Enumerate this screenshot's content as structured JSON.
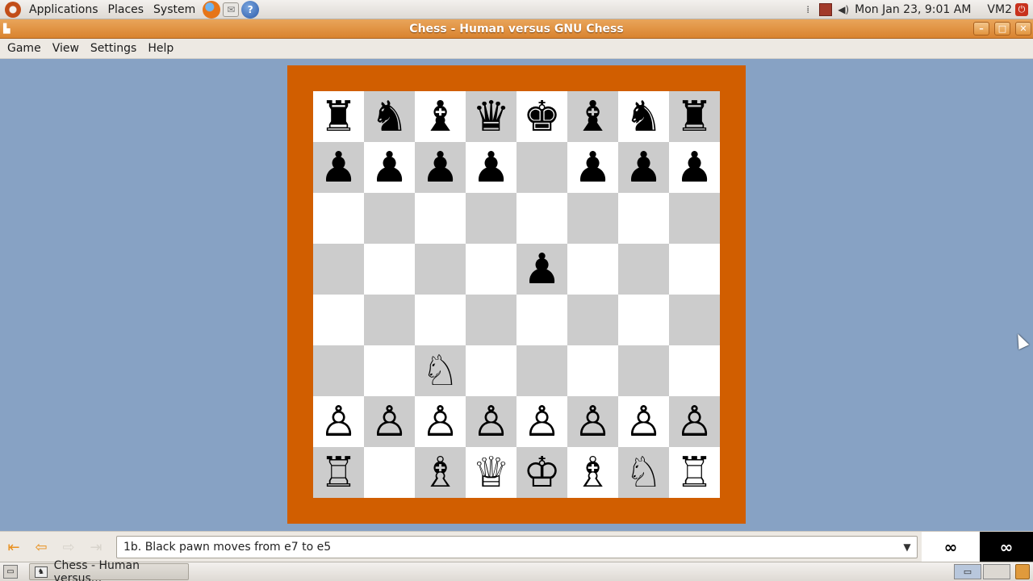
{
  "top_panel": {
    "menus": [
      "Applications",
      "Places",
      "System"
    ],
    "clock": "Mon Jan 23,  9:01 AM",
    "vm_label": "VM2",
    "icons": [
      "ubuntu-logo",
      "firefox-icon",
      "mail-icon",
      "help-icon",
      "network-icon",
      "volume-icon",
      "power-icon"
    ]
  },
  "window": {
    "title": "Chess - Human versus GNU Chess"
  },
  "menubar": {
    "game": "Game",
    "view": "View",
    "settings": "Settings",
    "help": "Help"
  },
  "board": {
    "light_color": "#ffffff",
    "dark_color": "#cccccc",
    "frame_color": "#d15e00",
    "ranks": [
      [
        "♜",
        "♞",
        "♝",
        "♛",
        "♚",
        "♝",
        "♞",
        "♜"
      ],
      [
        "♟",
        "♟",
        "♟",
        "♟",
        "",
        "♟",
        "♟",
        "♟"
      ],
      [
        "",
        "",
        "",
        "",
        "",
        "",
        "",
        ""
      ],
      [
        "",
        "",
        "",
        "",
        "♟",
        "",
        "",
        ""
      ],
      [
        "",
        "",
        "",
        "",
        "",
        "",
        "",
        ""
      ],
      [
        "",
        "",
        "♘",
        "",
        "",
        "",
        "",
        ""
      ],
      [
        "♙",
        "♙",
        "♙",
        "♙",
        "♙",
        "♙",
        "♙",
        "♙"
      ],
      [
        "♖",
        "",
        "♗",
        "♕",
        "♔",
        "♗",
        "♘",
        "♖"
      ]
    ]
  },
  "move_bar": {
    "current_move": "1b. Black pawn moves from e7 to e5",
    "white_clock": "∞",
    "black_clock": "∞"
  },
  "taskbar": {
    "task_label": "Chess - Human versus..."
  }
}
